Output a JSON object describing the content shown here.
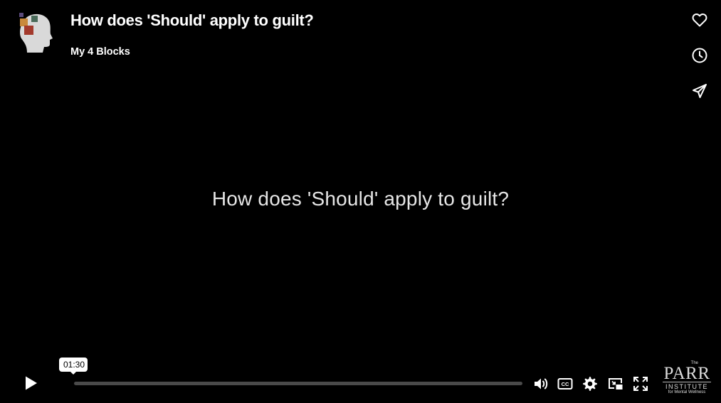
{
  "header": {
    "title": "How does 'Should' apply to guilt?",
    "channel": "My 4 Blocks"
  },
  "video": {
    "center_text": "How does 'Should' apply to guilt?"
  },
  "side_actions": [
    {
      "name": "like-button",
      "icon": "heart-icon"
    },
    {
      "name": "watch-later-button",
      "icon": "clock-icon"
    },
    {
      "name": "share-button",
      "icon": "send-icon"
    }
  ],
  "controls": {
    "hover_time": "01:30",
    "progress": 0.0
  },
  "brand": {
    "the": "The",
    "name": "PARR",
    "institute": "INSTITUTE",
    "tagline": "for Mental Wellness"
  },
  "colors": {
    "background": "#000000",
    "text": "#ffffff",
    "track": "#4a4a4a"
  }
}
